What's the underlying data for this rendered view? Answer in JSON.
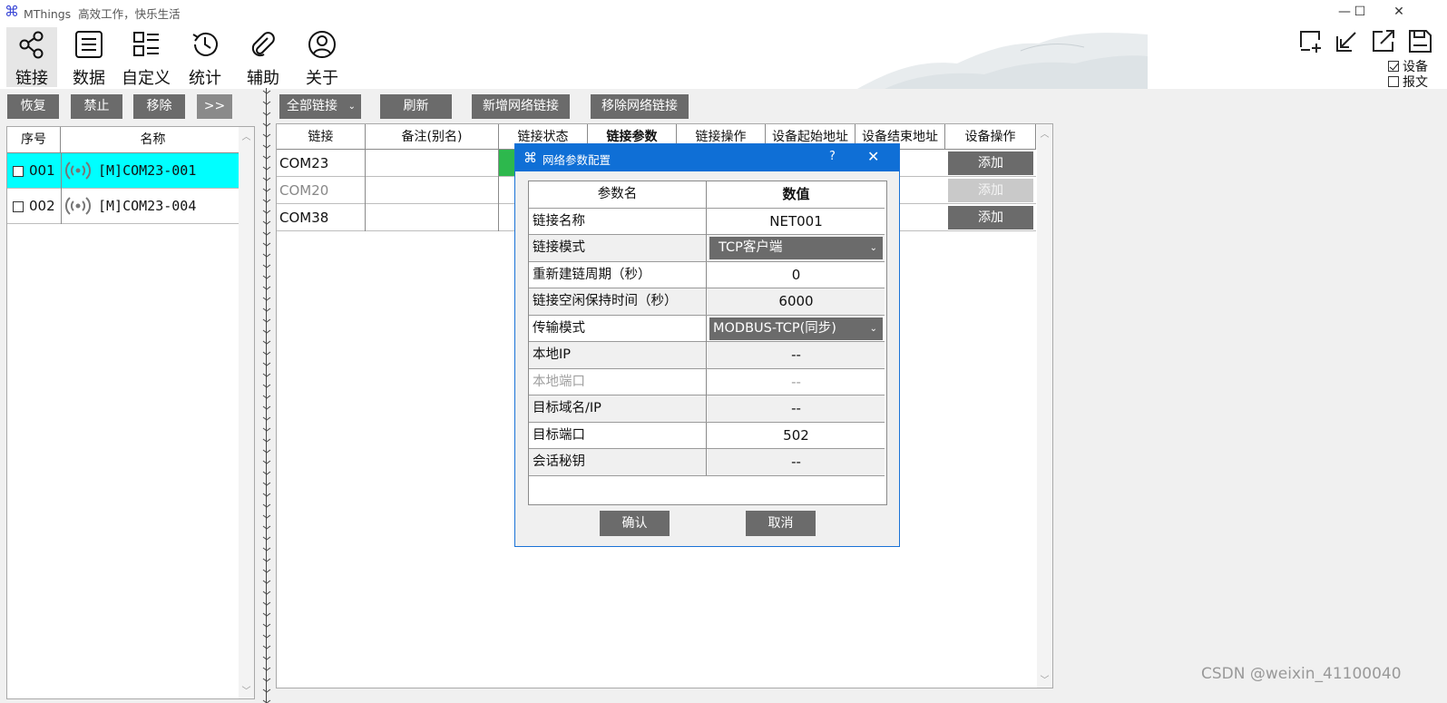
{
  "app": {
    "title": "MThings  高效工作，快乐生活",
    "window_controls": {
      "minimize": "—",
      "maximize": "☐",
      "close": "✕"
    }
  },
  "toolbar": {
    "tabs": [
      {
        "label": "链接",
        "icon": "share-nodes-icon"
      },
      {
        "label": "数据",
        "icon": "list-doc-icon"
      },
      {
        "label": "自定义",
        "icon": "custom-layout-icon"
      },
      {
        "label": "统计",
        "icon": "clock-history-icon"
      },
      {
        "label": "辅助",
        "icon": "paperclip-icon"
      },
      {
        "label": "关于",
        "icon": "user-circle-icon"
      }
    ],
    "active_tab": "链接",
    "options": [
      {
        "label": "设备",
        "checked": true
      },
      {
        "label": "报文",
        "checked": false
      }
    ]
  },
  "left_actions": {
    "restore": "恢复",
    "disable": "禁止",
    "remove": "移除",
    "expand": ">>"
  },
  "right_actions": {
    "all_links": "全部链接",
    "refresh": "刷新",
    "add_network": "新增网络链接",
    "remove_network": "移除网络链接"
  },
  "device_list": {
    "columns": [
      "序号",
      "名称"
    ],
    "rows": [
      {
        "id": "001",
        "name": "[M]COM23-001",
        "selected": true
      },
      {
        "id": "002",
        "name": "[M]COM23-004",
        "selected": false
      }
    ]
  },
  "link_grid": {
    "columns": [
      "链接",
      "备注(别名)",
      "链接状态",
      "链接参数",
      "链接操作",
      "设备起始地址",
      "设备结束地址",
      "设备操作"
    ],
    "rows": [
      {
        "link": "COM23",
        "action": "添加",
        "enabled": true
      },
      {
        "link": "COM20",
        "action": "添加",
        "enabled": false
      },
      {
        "link": "COM38",
        "action": "添加",
        "enabled": true
      }
    ]
  },
  "dialog": {
    "title": "网络参数配置",
    "help": "?",
    "close": "✕",
    "columns": [
      "参数名",
      "数值"
    ],
    "params": [
      {
        "name": "链接名称",
        "value": "NET001",
        "kind": "text"
      },
      {
        "name": "链接模式",
        "value": "TCP客户端",
        "kind": "select"
      },
      {
        "name": "重新建链周期（秒）",
        "value": "0",
        "kind": "text"
      },
      {
        "name": "链接空闲保持时间（秒）",
        "value": "6000",
        "kind": "text"
      },
      {
        "name": "传输模式",
        "value": "MODBUS-TCP(同步)",
        "kind": "select"
      },
      {
        "name": "本地IP",
        "value": "--",
        "kind": "text"
      },
      {
        "name": "本地端口",
        "value": "--",
        "kind": "disabled"
      },
      {
        "name": "目标域名/IP",
        "value": "--",
        "kind": "text"
      },
      {
        "name": "目标端口",
        "value": "502",
        "kind": "text"
      },
      {
        "name": "会话秘钥",
        "value": "--",
        "kind": "text"
      }
    ],
    "ok": "确认",
    "cancel": "取消"
  },
  "colors": {
    "selected_row": "#00ffff",
    "dialog_title": "#0f6fd6",
    "button": "#6b6b6b",
    "status_green": "#2db84d"
  },
  "watermark": "CSDN @weixin_41100040"
}
